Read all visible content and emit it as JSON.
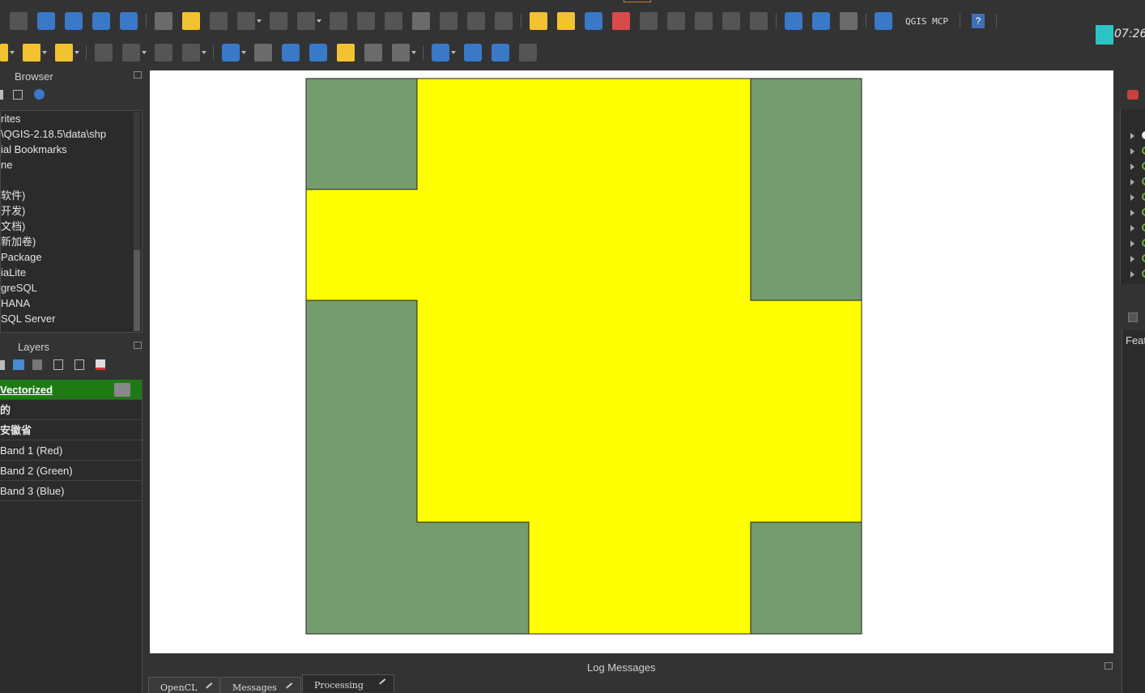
{
  "toolbar": {
    "plugin_label": "QGIS MCP",
    "help_label": "?",
    "clock": "07:26"
  },
  "browser": {
    "title": "Browser",
    "items": [
      "rites",
      "\\QGIS-2.18.5\\data\\shp",
      "ial Bookmarks",
      "ne",
      "",
      "软件)",
      "开发)",
      "文档)",
      "新加卷)",
      "Package",
      "iaLite",
      "greSQL",
      "HANA",
      "SQL Server"
    ]
  },
  "layers": {
    "title": "Layers",
    "items": [
      {
        "label": "Vectorized",
        "selected": true
      },
      {
        "label": "的",
        "bold": true
      },
      {
        "label": "安徽省",
        "bold": true
      },
      {
        "label": "Band 1 (Red)"
      },
      {
        "label": "Band 2 (Green)"
      },
      {
        "label": "Band 3 (Blue)"
      }
    ]
  },
  "map": {
    "fill_yellow": "#ffff00",
    "fill_green": "#759c6f",
    "stroke": "#222222"
  },
  "log": {
    "title": "Log Messages",
    "tabs": [
      "OpenCL",
      "Messages",
      "Processing"
    ],
    "active_tab": "Processing"
  },
  "right_panel": {
    "features_label": "Feat"
  },
  "colors": {
    "selected_layer": "#1f7a16",
    "background": "#333333"
  }
}
